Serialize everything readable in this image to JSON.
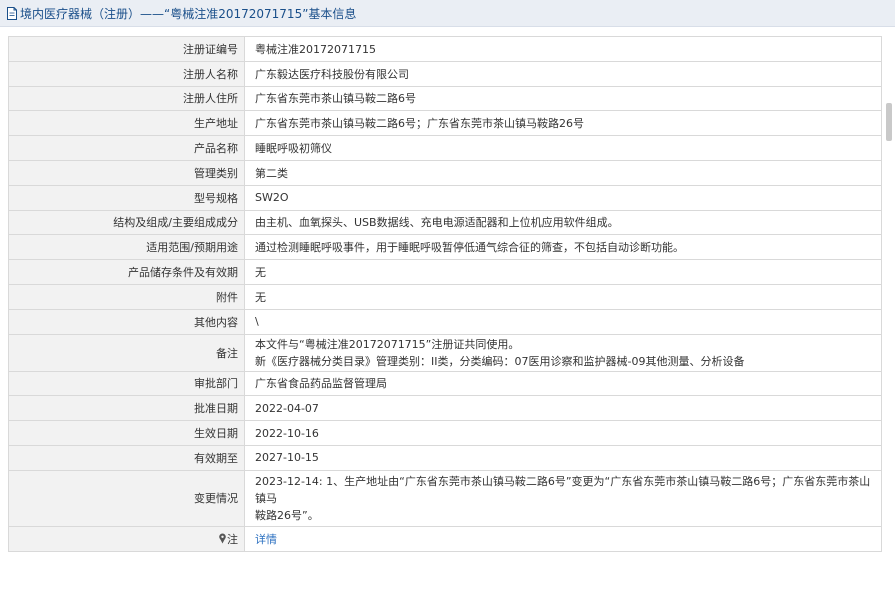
{
  "header": {
    "title": "境内医疗器械（注册）——“粤械注准20172071715”基本信息"
  },
  "rows": [
    {
      "label": "注册证编号",
      "value": "粤械注准20172071715"
    },
    {
      "label": "注册人名称",
      "value": "广东毅达医疗科技股份有限公司"
    },
    {
      "label": "注册人住所",
      "value": "广东省东莞市茶山镇马鞍二路6号"
    },
    {
      "label": "生产地址",
      "value": "广东省东莞市茶山镇马鞍二路6号；广东省东莞市茶山镇马鞍路26号"
    },
    {
      "label": "产品名称",
      "value": "睡眠呼吸初筛仪"
    },
    {
      "label": "管理类别",
      "value": "第二类"
    },
    {
      "label": "型号规格",
      "value": "SW2O"
    },
    {
      "label": "结构及组成/主要组成成分",
      "value": "由主机、血氧探头、USB数据线、充电电源适配器和上位机应用软件组成。"
    },
    {
      "label": "适用范围/预期用途",
      "value": "通过检测睡眠呼吸事件，用于睡眠呼吸暂停低通气综合征的筛查，不包括自动诊断功能。"
    },
    {
      "label": "产品储存条件及有效期",
      "value": "无"
    },
    {
      "label": "附件",
      "value": "无"
    },
    {
      "label": "其他内容",
      "value": "\\"
    }
  ],
  "remark": {
    "label": "备注",
    "line1": "本文件与“粤械注准20172071715”注册证共同使用。",
    "line2": "新《医疗器械分类目录》管理类别：II类，分类编码：07医用诊察和监护器械-09其他测量、分析设备"
  },
  "rows2": [
    {
      "label": "审批部门",
      "value": "广东省食品药品监督管理局"
    },
    {
      "label": "批准日期",
      "value": "2022-04-07"
    },
    {
      "label": "生效日期",
      "value": "2022-10-16"
    },
    {
      "label": "有效期至",
      "value": "2027-10-15"
    }
  ],
  "change": {
    "label": "变更情况",
    "line1": "2023-12-14: 1、生产地址由“广东省东莞市茶山镇马鞍二路6号”变更为“广东省东莞市茶山镇马鞍二路6号；广东省东莞市茶山镇马",
    "line2": "鞍路26号”。"
  },
  "note": {
    "label": "注",
    "link": "详情"
  },
  "colors": {
    "link": "#2a6fc0",
    "title": "#1a4f8a",
    "label_bg": "#f2f2f2",
    "border": "#d9d9d9"
  }
}
